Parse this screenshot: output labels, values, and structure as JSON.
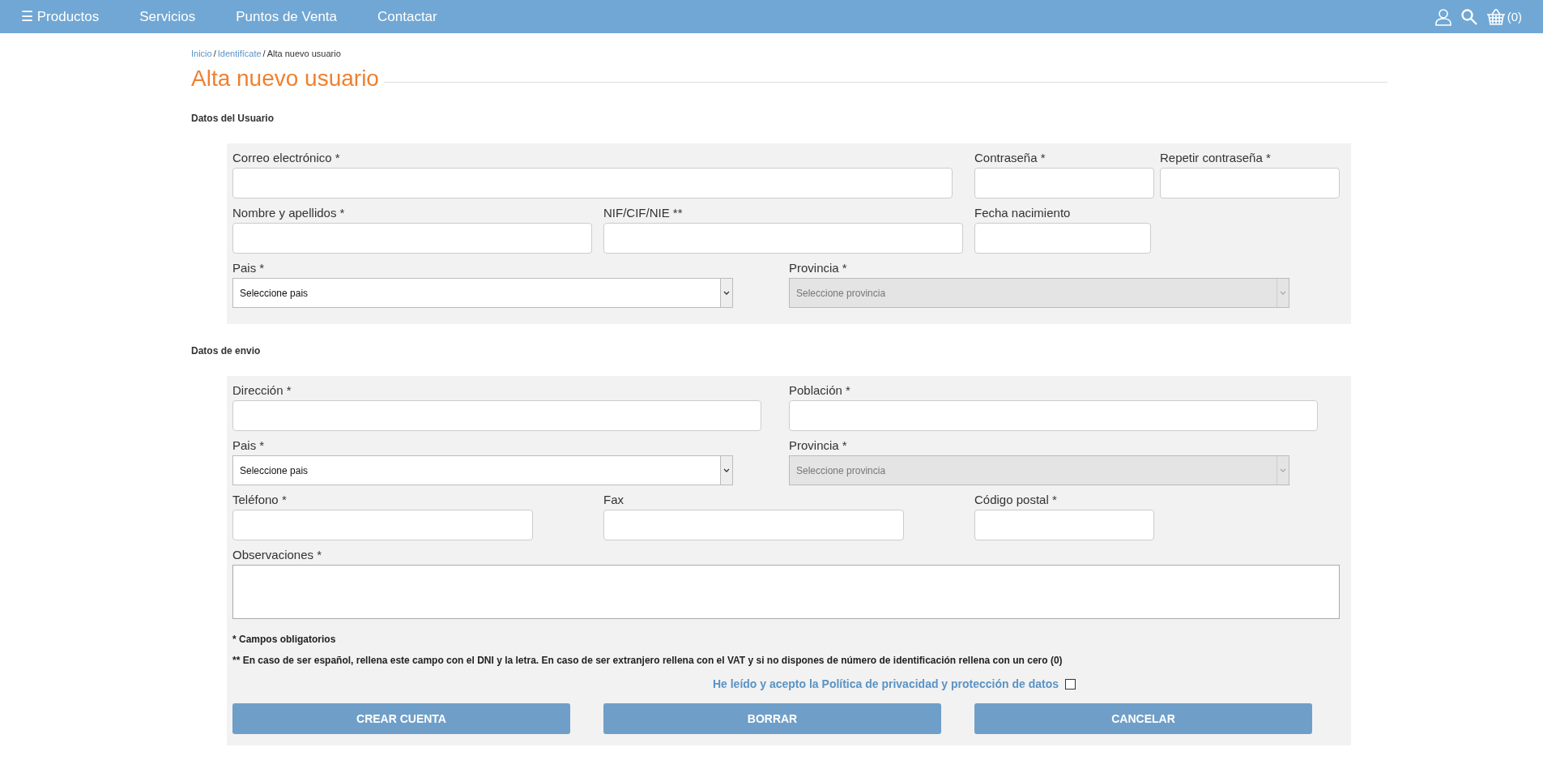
{
  "nav": {
    "menu_icon": "☰",
    "items": [
      "Productos",
      "Servicios",
      "Puntos de Venta",
      "Contactar"
    ],
    "cart_count": "(0)"
  },
  "breadcrumb": [
    {
      "label": "Inicio",
      "link": true
    },
    {
      "label": "Identifícate",
      "link": true
    },
    {
      "label": "Alta nuevo usuario",
      "link": false
    }
  ],
  "breadcrumb_separator": "/",
  "title": "Alta nuevo usuario",
  "sections": [
    {
      "title": "Datos del Usuario",
      "rows": [
        {
          "fields": [
            {
              "kind": "text",
              "label": "Correo electrónico *"
            },
            {
              "kind": "text",
              "label": "Contraseña *"
            },
            {
              "kind": "text",
              "label": "Repetir contraseña *"
            }
          ]
        },
        {
          "fields": [
            {
              "kind": "text",
              "label": "Nombre y apellidos *"
            },
            {
              "kind": "text",
              "label": "NIF/CIF/NIE **"
            },
            {
              "kind": "text",
              "label": "Fecha nacimiento"
            }
          ]
        },
        {
          "fields": [
            {
              "kind": "select",
              "label": "Pais *",
              "value": "Seleccione pais",
              "disabled": false
            },
            {
              "kind": "select",
              "label": "Provincia *",
              "value": "Seleccione provincia",
              "disabled": true
            }
          ]
        }
      ]
    },
    {
      "title": "Datos de envio",
      "rows": [
        {
          "fields": [
            {
              "kind": "text",
              "label": "Dirección *"
            },
            {
              "kind": "text",
              "label": "Población *"
            }
          ]
        },
        {
          "fields": [
            {
              "kind": "select",
              "label": "Pais *",
              "value": "Seleccione pais",
              "disabled": false
            },
            {
              "kind": "select",
              "label": "Provincia *",
              "value": "Seleccione provincia",
              "disabled": true
            }
          ]
        },
        {
          "fields": [
            {
              "kind": "text",
              "label": "Teléfono *"
            },
            {
              "kind": "text",
              "label": "Fax"
            },
            {
              "kind": "text",
              "label": "Código postal *"
            }
          ]
        },
        {
          "fields": [
            {
              "kind": "textarea",
              "label": "Observaciones *"
            }
          ]
        }
      ],
      "notes": [
        "* Campos obligatorios",
        "** En caso de ser español, rellena este campo con el DNI y la letra. En caso de ser extranjero rellena con el VAT y si no dispones de número de identificación rellena con un cero (0)"
      ],
      "privacy": {
        "label": "He leído y acepto la Política de privacidad y protección de datos",
        "checked": false
      },
      "buttons": [
        "CREAR CUENTA",
        "BORRAR",
        "CANCELAR"
      ]
    }
  ]
}
